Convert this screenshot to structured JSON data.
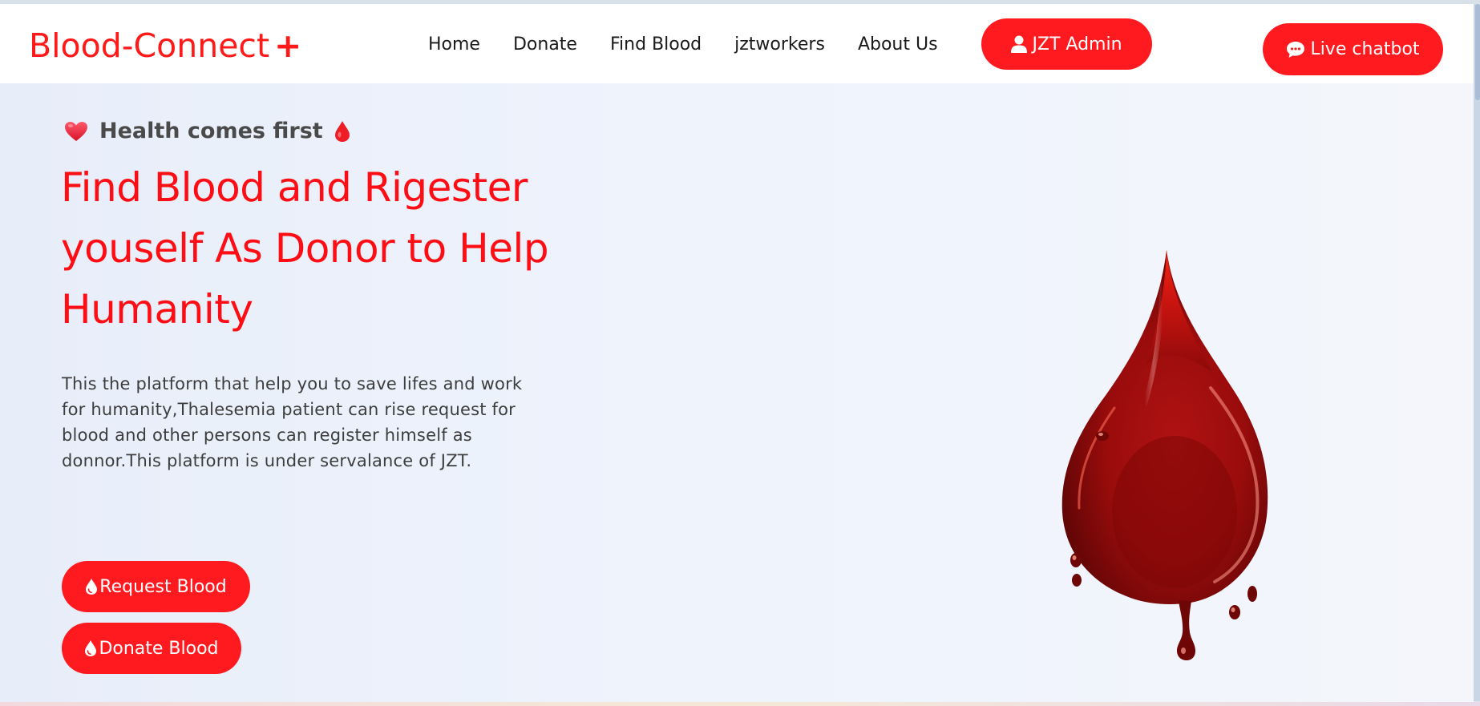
{
  "brand": {
    "name": "Blood-Connect",
    "plus": "+"
  },
  "nav": {
    "links": [
      "Home",
      "Donate",
      "Find Blood",
      "jztworkers",
      "About Us"
    ],
    "admin_label": "JZT Admin",
    "chatbot_label": "Live chatbot"
  },
  "hero": {
    "tagline": "Health comes first",
    "headline": "Find Blood and Rigester youself As Donor to Help Humanity",
    "description": "This the platform that help you to save lifes and work for humanity,Thalesemia patient can rise request for blood and other persons can register himself as donnor.This platform is under servalance of JZT.",
    "request_button": "Request Blood",
    "donate_button": "Donate Blood"
  },
  "icons": {
    "admin": "user-icon",
    "chatbot": "chat-bubble-icon",
    "tagline_left": "heart-icon",
    "tagline_right": "blood-drop-icon",
    "buttons": "droplet-icon",
    "hero_image": "blood-drop-image"
  },
  "colors": {
    "accent": "#ff1a1f",
    "headline": "#ff0d14",
    "hero_bg": "#eef3fc",
    "text": "#3d3d3d"
  }
}
